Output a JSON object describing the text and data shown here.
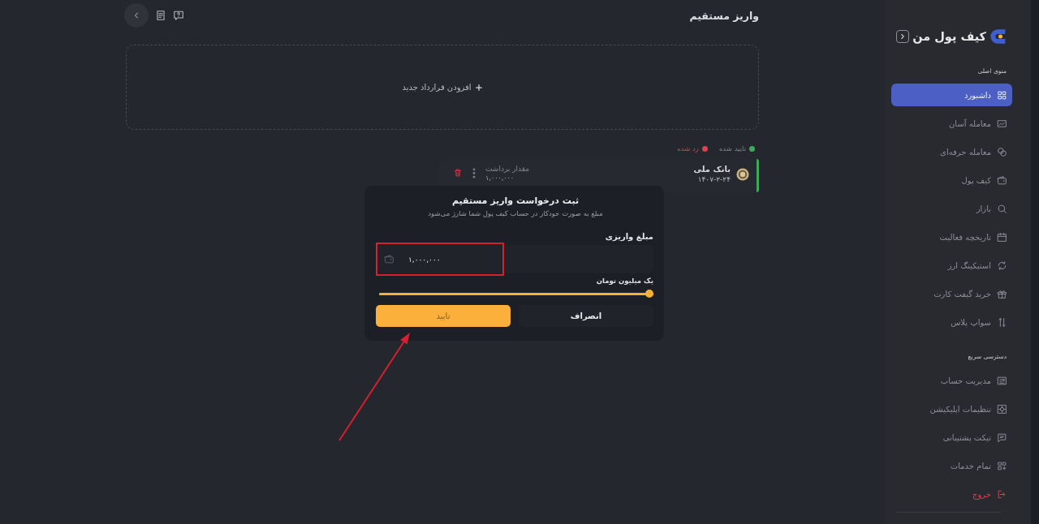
{
  "header": {
    "title": "واریز مستقیم"
  },
  "add_contract": {
    "label": "افزودن قرارداد جدید"
  },
  "legend": [
    {
      "label": "تایید شده",
      "color": "#3fa95b",
      "kind": "approved"
    },
    {
      "label": "رد شده",
      "color": "#d8434e",
      "kind": "rejected"
    }
  ],
  "contracts": [
    {
      "bank": "بانک ملی",
      "date": "۱۴۰۷-۲-۲۴",
      "amount_label": "مقدار برداشت",
      "amount": "۱,۰۰۰,۰۰۰",
      "color": "#3fa95b"
    }
  ],
  "dialog": {
    "title": "ثبت درخواست واریز مستقیم",
    "subtitle": "مبلغ به صورت خودکار در حساب کیف پول شما شارژ می‌شود",
    "field_label": "مبلغ واریزی",
    "value": "۱,۰۰۰,۰۰۰",
    "amount_words": "یک میلیون تومان",
    "slider": {
      "level": 1
    },
    "buttons": [
      {
        "label": "انصراف",
        "kind": "secondary"
      },
      {
        "label": "تایید",
        "kind": "primary"
      }
    ]
  },
  "sidebar": {
    "logo_text": "کیف پول من",
    "sections": [
      {
        "title": "منوی اصلی",
        "items": [
          {
            "label": "داشبورد",
            "selected": true,
            "kind": "link"
          },
          {
            "label": "معامله آسان",
            "selected": false,
            "kind": "link"
          },
          {
            "label": "معامله حرفه‌ای",
            "selected": false,
            "kind": "link"
          },
          {
            "label": "کیف پول",
            "selected": false,
            "kind": "link"
          },
          {
            "label": "بازار",
            "selected": false,
            "kind": "link"
          },
          {
            "label": "تاریخچه فعالیت",
            "selected": false,
            "kind": "link"
          },
          {
            "label": "استیکینگ ارز",
            "selected": false,
            "kind": "link"
          },
          {
            "label": "خرید گیفت کارت",
            "selected": false,
            "kind": "link"
          },
          {
            "label": "سواپ پلاس",
            "selected": false,
            "kind": "link"
          }
        ]
      },
      {
        "title": "دسترسی سریع",
        "items": [
          {
            "label": "مدیریت حساب",
            "selected": false,
            "kind": "link"
          },
          {
            "label": "تنظیمات اپلیکیشن",
            "selected": false,
            "kind": "link"
          },
          {
            "label": "تیکت پشتیبانی",
            "selected": false,
            "kind": "link"
          },
          {
            "label": "تمام خدمات",
            "selected": false,
            "kind": "link"
          },
          {
            "label": "خروج",
            "selected": false,
            "kind": "danger"
          }
        ]
      }
    ]
  }
}
